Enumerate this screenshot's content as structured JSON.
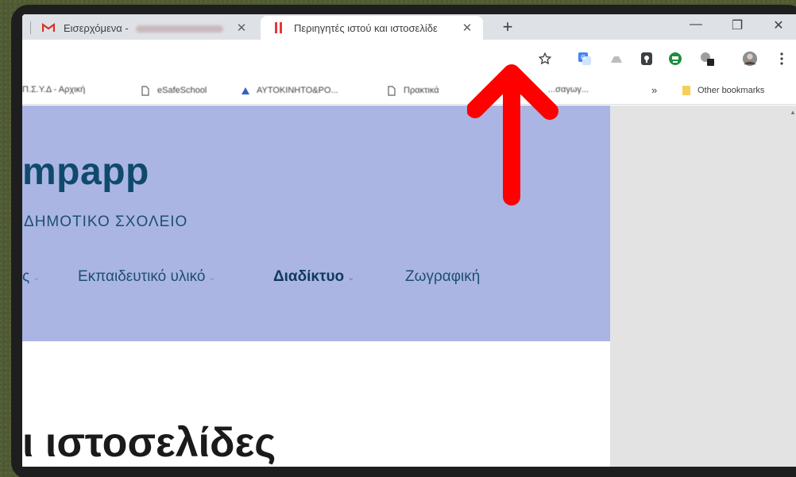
{
  "tabs": [
    {
      "title": "Εισερχόμενα - ",
      "icon": "gmail-icon",
      "close": "✕"
    },
    {
      "title": "Περιηγητές ιστού και ιστοσελίδε",
      "icon": "site-favicon-icon",
      "close": "✕"
    }
  ],
  "newtab": "+",
  "window": {
    "minimize": "—",
    "maximize": "❐",
    "close": "✕"
  },
  "bookmarks": {
    "items": [
      {
        "label": "Π.Σ.Υ.Δ - Αρχική",
        "icon": "globe-icon"
      },
      {
        "label": "eSafeSchool",
        "icon": "page-icon"
      },
      {
        "label": "ΑΥΤΟΚΙΝΗΤΟ&ΡΟ...",
        "icon": "triangle-icon"
      },
      {
        "label": "Πρακτικά",
        "icon": "page-icon"
      },
      {
        "label": "...σαγωγ...",
        "icon": "page-icon"
      }
    ],
    "more": "»",
    "other": "Other bookmarks"
  },
  "page": {
    "site_title": "mpapp",
    "site_subtitle": "ΔΗΜΟΤΙΚΟ ΣΧΟΛΕΙΟ",
    "nav": [
      {
        "label": "ς",
        "caret": "⌄"
      },
      {
        "label": "Εκπαιδευτικό υλικό",
        "caret": "⌄"
      },
      {
        "label": "Διαδίκτυο",
        "caret": "⌄"
      },
      {
        "label": "Ζωγραφική",
        "caret": ""
      }
    ],
    "heading": "ι ιστοσελίδες"
  },
  "colors": {
    "hero": "#abb5e3",
    "title": "#0f4a6e",
    "arrow": "#ff0000"
  }
}
